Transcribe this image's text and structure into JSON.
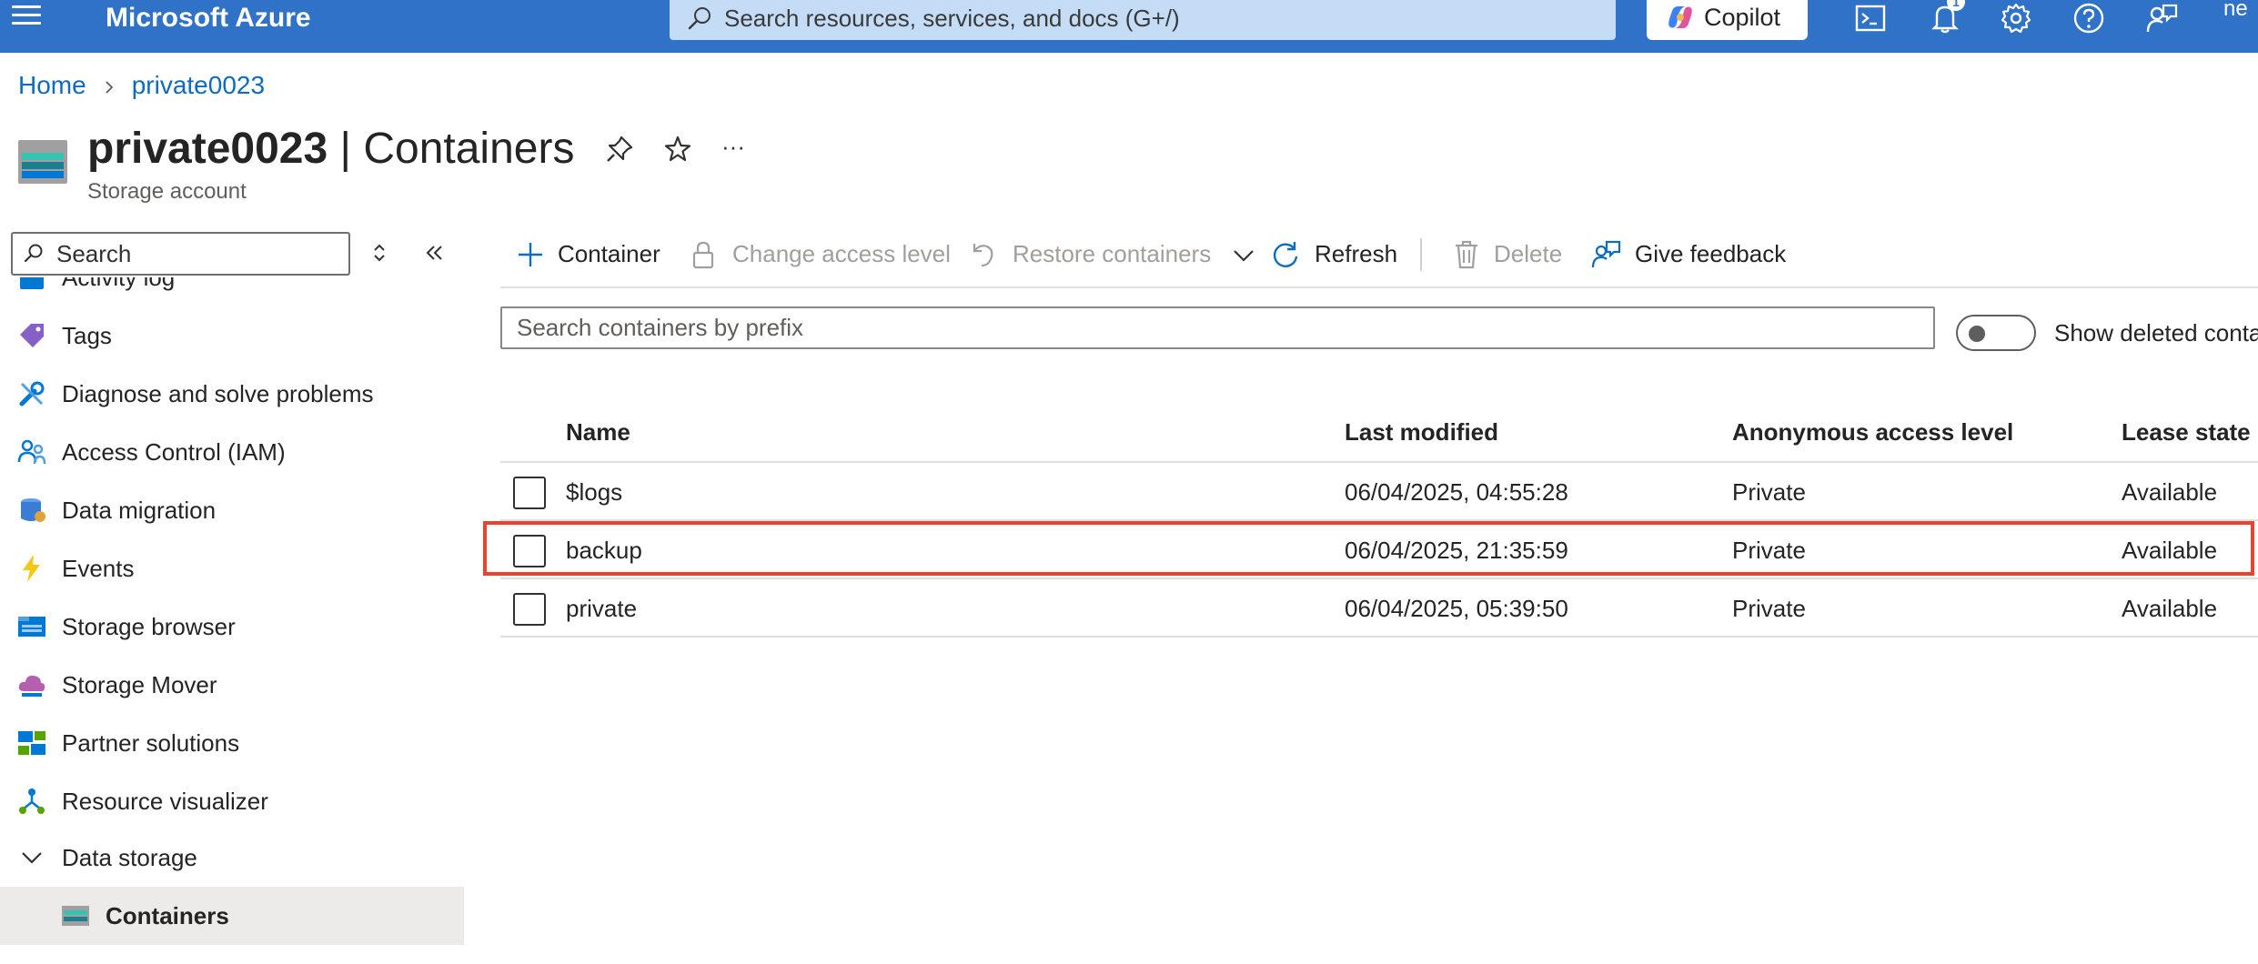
{
  "topbar": {
    "brand": "Microsoft Azure",
    "search_placeholder": "Search resources, services, and docs (G+/)",
    "copilot_label": "Copilot",
    "notification_count": "1",
    "account_initials": "ne",
    "icons": [
      "hamburger-icon",
      "search-icon",
      "copilot-icon",
      "cloud-shell-icon",
      "bell-icon",
      "gear-icon",
      "help-icon",
      "feedback-icon"
    ]
  },
  "breadcrumb": {
    "items": [
      "Home",
      "private0023"
    ]
  },
  "header": {
    "title_bold": "private0023",
    "title_rest": " | Containers",
    "subtitle": "Storage account",
    "more": "···"
  },
  "nav": {
    "search_placeholder": "Search",
    "items": [
      {
        "label": "Activity log",
        "icon": "activity-log-icon"
      },
      {
        "label": "Tags",
        "icon": "tag-icon"
      },
      {
        "label": "Diagnose and solve problems",
        "icon": "wrench-icon"
      },
      {
        "label": "Access Control (IAM)",
        "icon": "people-icon"
      },
      {
        "label": "Data migration",
        "icon": "data-migration-icon"
      },
      {
        "label": "Events",
        "icon": "lightning-icon"
      },
      {
        "label": "Storage browser",
        "icon": "storage-browser-icon"
      },
      {
        "label": "Storage Mover",
        "icon": "storage-mover-icon"
      },
      {
        "label": "Partner solutions",
        "icon": "partner-solutions-icon"
      },
      {
        "label": "Resource visualizer",
        "icon": "resource-visualizer-icon"
      },
      {
        "label": "Data storage",
        "icon": "chevron-down-icon"
      },
      {
        "label": "Containers",
        "icon": "containers-icon",
        "selected": true
      }
    ]
  },
  "commands": {
    "container": "Container",
    "change_access": "Change access level",
    "restore": "Restore containers",
    "refresh": "Refresh",
    "delete": "Delete",
    "feedback": "Give feedback"
  },
  "filter": {
    "prefix_placeholder": "Search containers by prefix",
    "toggle_label": "Show deleted containers",
    "toggle_on": false
  },
  "table": {
    "columns": [
      "Name",
      "Last modified",
      "Anonymous access level",
      "Lease state"
    ],
    "rows": [
      {
        "name": "$logs",
        "modified": "06/04/2025, 04:55:28",
        "access": "Private",
        "lease": "Available"
      },
      {
        "name": "backup",
        "modified": "06/04/2025, 21:35:59",
        "access": "Private",
        "lease": "Available",
        "highlighted": true
      },
      {
        "name": "private",
        "modified": "06/04/2025, 05:39:50",
        "access": "Private",
        "lease": "Available"
      }
    ]
  },
  "colors": {
    "topbar": "#2f72c8",
    "link": "#0f6cbd",
    "highlight_border": "#e8432e"
  }
}
